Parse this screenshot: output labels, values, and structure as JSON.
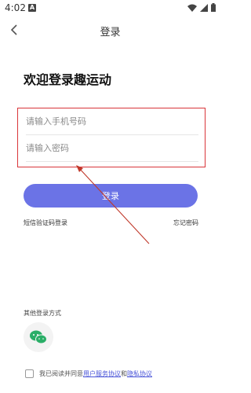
{
  "status": {
    "time": "4:02",
    "notif": "A"
  },
  "nav": {
    "title": "登录"
  },
  "welcome": "欢迎登录趣运动",
  "form": {
    "phone_placeholder": "请输入手机号码",
    "password_placeholder": "请输入密码"
  },
  "login_button": "登录",
  "sms_login": "短信验证码登录",
  "forgot_password": "忘记密码",
  "other_login_label": "其他登录方式",
  "agreement": {
    "prefix": "我已阅读并同意",
    "user_service": "用户服务协议",
    "and": "和",
    "privacy": "隐私协议"
  },
  "colors": {
    "accent": "#6b73e6",
    "highlight": "#d9353a",
    "link": "#4a55d8",
    "wechat": "#2aae67"
  }
}
